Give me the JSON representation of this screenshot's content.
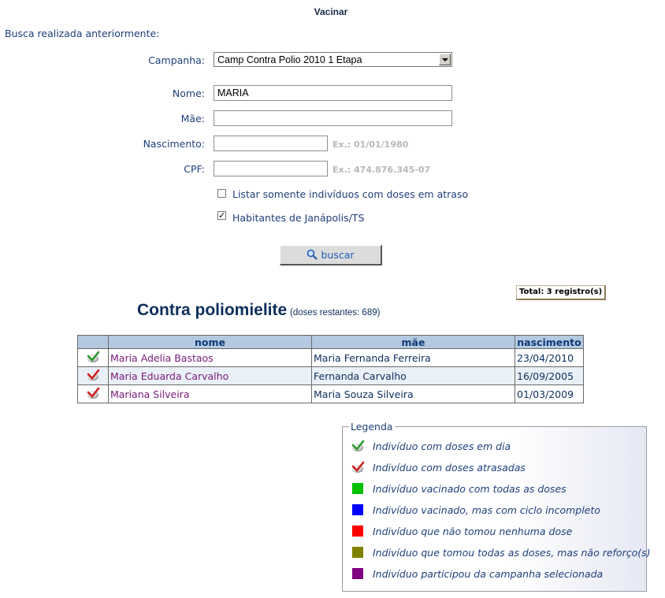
{
  "page": {
    "title": "Vacinar",
    "intro": "Busca realizada anteriormente:"
  },
  "form": {
    "campanha": {
      "label": "Campanha:",
      "value": "Camp Contra Polio 2010 1 Etapa"
    },
    "nome": {
      "label": "Nome:",
      "value": "MARIA"
    },
    "mae": {
      "label": "Mãe:",
      "value": ""
    },
    "nascimento": {
      "label": "Nascimento:",
      "value": "",
      "hint": "Ex.: 01/01/1980"
    },
    "cpf": {
      "label": "CPF:",
      "value": "",
      "hint": "Ex.: 474.876.345-07"
    },
    "atraso": {
      "label": "Listar somente indivíduos com doses em atraso",
      "checked": false
    },
    "habitantes": {
      "label": "Habitantes de Janápolis/TS",
      "checked": true
    },
    "search_button": "buscar"
  },
  "results": {
    "total": "Total: 3 registro(s)",
    "title": "Contra poliomielite",
    "subtitle": "(doses restantes: 689)",
    "columns": [
      "nome",
      "mãe",
      "nascimento"
    ],
    "rows": [
      {
        "status": "check-green",
        "nome": "Maria Adelia Bastaos",
        "mae": "Maria Fernanda Ferreira",
        "nascimento": "23/04/2010"
      },
      {
        "status": "check-red",
        "nome": "Maria Eduarda Carvalho",
        "mae": "Fernanda Carvalho",
        "nascimento": "16/09/2005"
      },
      {
        "status": "check-red",
        "nome": "Mariana Silveira",
        "mae": "Maria Souza Silveira",
        "nascimento": "01/03/2009"
      }
    ]
  },
  "legend": {
    "title": "Legenda",
    "items": [
      {
        "icon": "check-green",
        "text": "Indivíduo com doses em dia"
      },
      {
        "icon": "check-red",
        "text": "Indivíduo com doses atrasadas"
      },
      {
        "color": "#00c000",
        "text": "Indivíduo vacinado com todas as doses"
      },
      {
        "color": "#0000ff",
        "text": "Indivíduo vacinado, mas com ciclo incompleto"
      },
      {
        "color": "#ff0000",
        "text": "Indivíduo que não tomou nenhuma dose"
      },
      {
        "color": "#808000",
        "text": "Indivíduo que tomou todas as doses, mas não reforço(s)"
      },
      {
        "color": "#800080",
        "text": "Indivíduo participou da campanha selecionada"
      }
    ]
  }
}
